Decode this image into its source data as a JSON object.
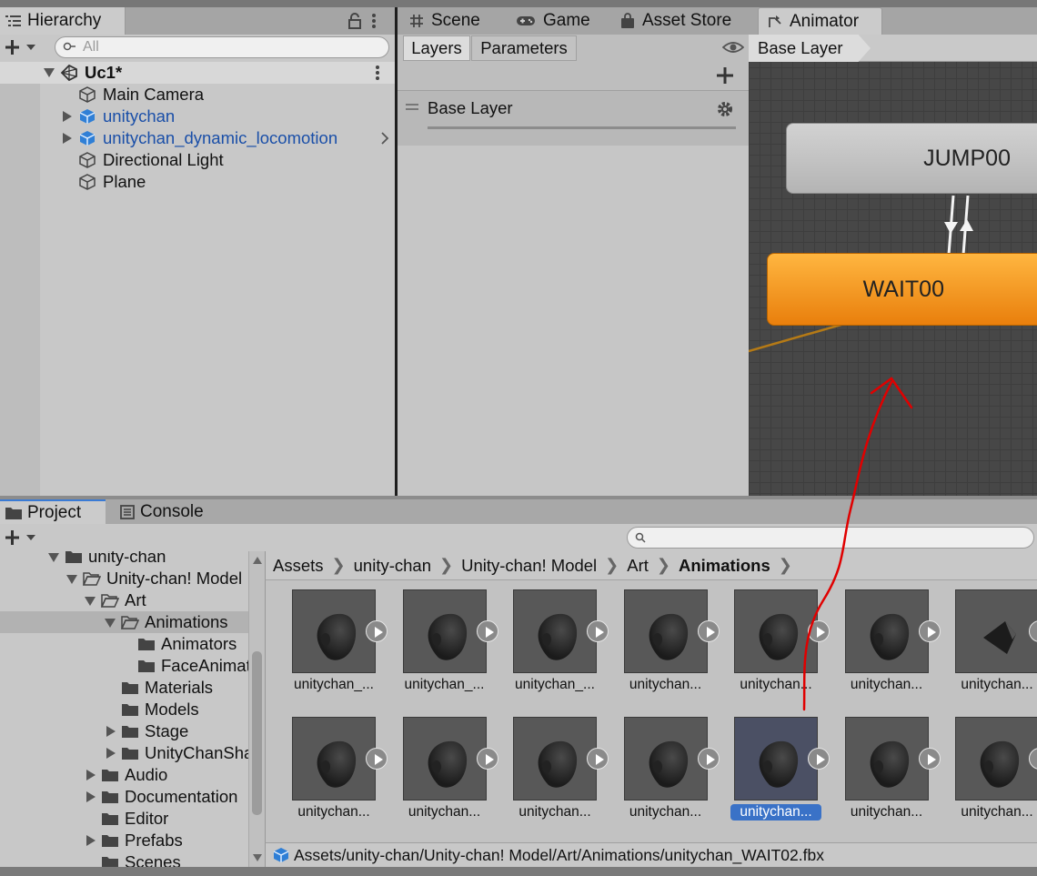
{
  "hierarchy": {
    "tab_label": "Hierarchy",
    "search_placeholder": "All",
    "scene_name": "Uc1*",
    "items": [
      {
        "label": "Main Camera",
        "prefab": false,
        "expandable": false
      },
      {
        "label": "unitychan",
        "prefab": true,
        "expandable": true
      },
      {
        "label": "unitychan_dynamic_locomotion",
        "prefab": true,
        "expandable": true
      },
      {
        "label": "Directional Light",
        "prefab": false,
        "expandable": false
      },
      {
        "label": "Plane",
        "prefab": false,
        "expandable": false
      }
    ]
  },
  "center_tabs": [
    "Scene",
    "Game",
    "Asset Store",
    "Animator"
  ],
  "animator": {
    "subtabs": [
      "Layers",
      "Parameters"
    ],
    "layer_name": "Base Layer",
    "breadcrumb": "Base Layer",
    "states": [
      {
        "label": "JUMP00",
        "color": "#c4c4c4"
      },
      {
        "label": "WAIT00",
        "color": "#f19a1c"
      }
    ]
  },
  "bottom_tabs": [
    "Project",
    "Console"
  ],
  "project_tree": [
    {
      "label": "unity-chan",
      "indent": 1,
      "expand": "down",
      "partial": true
    },
    {
      "label": "Unity-chan! Model",
      "indent": 2,
      "expand": "down",
      "open": true
    },
    {
      "label": "Art",
      "indent": 3,
      "expand": "down",
      "open": true
    },
    {
      "label": "Animations",
      "indent": 4,
      "expand": "down",
      "open": true,
      "selected": true
    },
    {
      "label": "Animators",
      "indent": 5,
      "expand": "none"
    },
    {
      "label": "FaceAnimatio",
      "indent": 5,
      "expand": "none"
    },
    {
      "label": "Materials",
      "indent": 4,
      "expand": "none"
    },
    {
      "label": "Models",
      "indent": 4,
      "expand": "none"
    },
    {
      "label": "Stage",
      "indent": 4,
      "expand": "right"
    },
    {
      "label": "UnityChanShad",
      "indent": 4,
      "expand": "right"
    },
    {
      "label": "Audio",
      "indent": 3,
      "expand": "right"
    },
    {
      "label": "Documentation",
      "indent": 3,
      "expand": "right"
    },
    {
      "label": "Editor",
      "indent": 3,
      "expand": "none"
    },
    {
      "label": "Prefabs",
      "indent": 3,
      "expand": "right"
    },
    {
      "label": "Scenes",
      "indent": 3,
      "expand": "none"
    }
  ],
  "breadcrumbs": [
    "Assets",
    "unity-chan",
    "Unity-chan! Model",
    "Art",
    "Animations"
  ],
  "assets_row1": [
    "unitychan_...",
    "unitychan_...",
    "unitychan_...",
    "unitychan...",
    "unitychan...",
    "unitychan...",
    "unitychan..."
  ],
  "assets_row2": [
    "unitychan...",
    "unitychan...",
    "unitychan...",
    "unitychan...",
    "unitychan...",
    "unitychan...",
    "unitychan..."
  ],
  "selected_asset_index_row2": 4,
  "status_path": "Assets/unity-chan/Unity-chan! Model/Art/Animations/unitychan_WAIT02.fbx",
  "annotation_color": "#e00000"
}
